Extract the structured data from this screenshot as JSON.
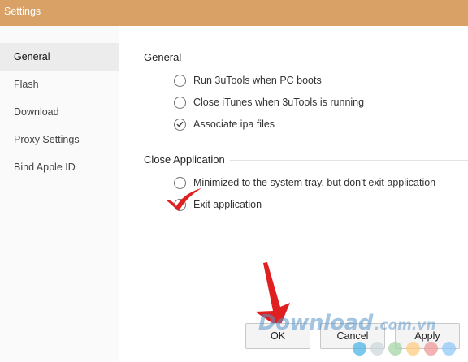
{
  "window": {
    "title": "Settings"
  },
  "sidebar": {
    "items": [
      {
        "label": "General",
        "active": true
      },
      {
        "label": "Flash",
        "active": false
      },
      {
        "label": "Download",
        "active": false
      },
      {
        "label": "Proxy Settings",
        "active": false
      },
      {
        "label": "Bind Apple ID",
        "active": false
      }
    ]
  },
  "general": {
    "title": "General",
    "options": [
      {
        "label": "Run 3uTools when PC boots",
        "checked": false
      },
      {
        "label": "Close iTunes when 3uTools is running",
        "checked": false
      },
      {
        "label": "Associate ipa files",
        "checked": true
      }
    ]
  },
  "close_app": {
    "title": "Close Application",
    "options": [
      {
        "label": "Minimized to the system tray, but don't exit application",
        "checked": false
      },
      {
        "label": "Exit application",
        "checked": true
      }
    ]
  },
  "buttons": {
    "ok": "OK",
    "cancel": "Cancel",
    "apply": "Apply"
  },
  "watermark": {
    "text": "Download",
    "tld": ".com.vn",
    "dot_colors": [
      "#4db6e8",
      "#cfd8dc",
      "#a5d6a7",
      "#ffcc80",
      "#ef9a9a",
      "#90caf9"
    ]
  },
  "colors": {
    "titlebar": "#d9a166",
    "annotation": "#e02020",
    "check": "#444444"
  }
}
